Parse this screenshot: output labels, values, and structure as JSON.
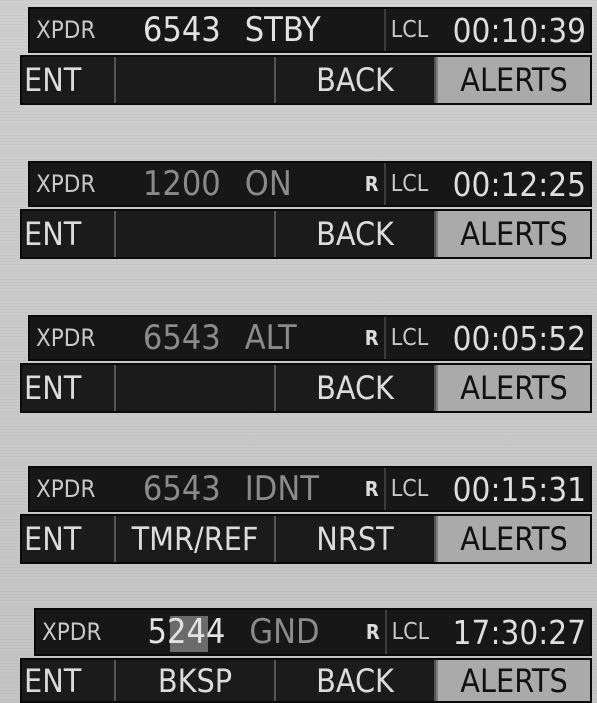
{
  "panels": [
    {
      "xpdr_label": "XPDR",
      "code": "6543",
      "mode": "STBY",
      "reply_indicator": "",
      "time_label": "LCL",
      "time": "00:10:39",
      "softkeys": [
        "ENT",
        "",
        "BACK",
        "ALERTS"
      ]
    },
    {
      "xpdr_label": "XPDR",
      "code": "1200",
      "mode": "ON",
      "reply_indicator": "R",
      "time_label": "LCL",
      "time": "00:12:25",
      "softkeys": [
        "ENT",
        "",
        "BACK",
        "ALERTS"
      ]
    },
    {
      "xpdr_label": "XPDR",
      "code": "6543",
      "mode": "ALT",
      "reply_indicator": "R",
      "time_label": "LCL",
      "time": "00:05:52",
      "softkeys": [
        "ENT",
        "",
        "BACK",
        "ALERTS"
      ]
    },
    {
      "xpdr_label": "XPDR",
      "code": "6543",
      "mode": "IDNT",
      "reply_indicator": "R",
      "time_label": "LCL",
      "time": "00:15:31",
      "softkeys": [
        "ENT",
        "TMR/REF",
        "NRST",
        "ALERTS"
      ]
    },
    {
      "xpdr_label": "XPDR",
      "code": "5244",
      "mode": "GND",
      "reply_indicator": "R",
      "time_label": "LCL",
      "time": "17:30:27",
      "softkeys": [
        "ENT",
        "BKSP",
        "BACK",
        "ALERTS"
      ]
    }
  ],
  "colors": {
    "background": "#c9c9c9",
    "bar": "#171717",
    "text": "#dcdcdc",
    "dim_text": "#8b8b8b",
    "alerts_key": "#aaaaaa"
  }
}
